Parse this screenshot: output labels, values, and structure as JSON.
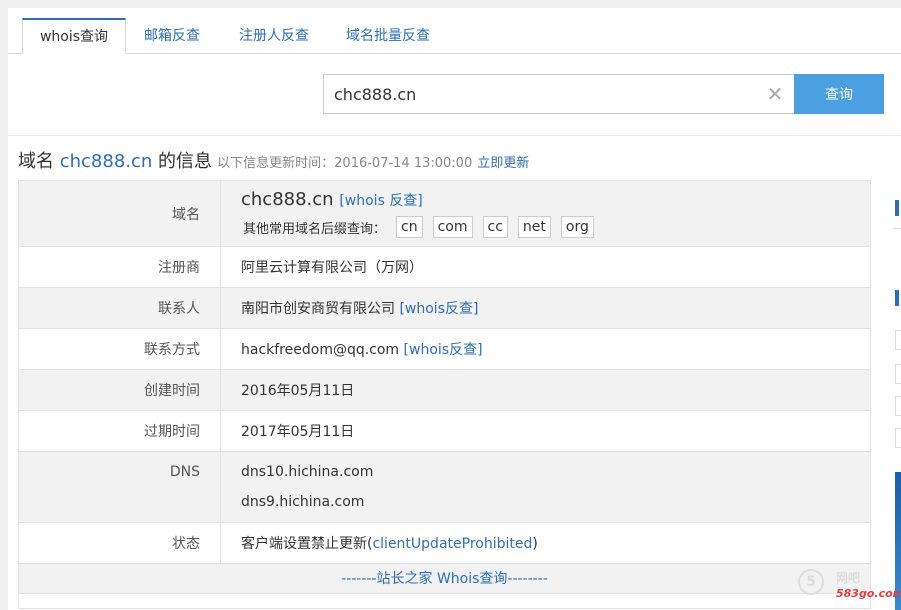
{
  "tabs": [
    {
      "label": "whois查询",
      "active": true
    },
    {
      "label": "邮箱反查",
      "active": false
    },
    {
      "label": "注册人反查",
      "active": false
    },
    {
      "label": "域名批量反查",
      "active": false
    }
  ],
  "search": {
    "value": "chc888.cn",
    "button_label": "查询"
  },
  "heading": {
    "prefix": "域名 ",
    "domain": "chc888.cn",
    "suffix": " 的信息",
    "update_text": "以下信息更新时间：2016-07-14 13:00:00",
    "update_link": "立即更新"
  },
  "table": {
    "domain": {
      "label": "域名",
      "value": "chc888.cn",
      "reverse_link": "[whois 反查]",
      "suffix_text": "其他常用域名后缀查询：",
      "suffixes": [
        "cn",
        "com",
        "cc",
        "net",
        "org"
      ]
    },
    "registrar": {
      "label": "注册商",
      "value": "阿里云计算有限公司（万网）"
    },
    "contact": {
      "label": "联系人",
      "value": "南阳市创安商贸有限公司",
      "link": "[whois反查]"
    },
    "contact_method": {
      "label": "联系方式",
      "value": "hackfreedom@qq.com",
      "link": "[whois反查]"
    },
    "created": {
      "label": "创建时间",
      "value": "2016年05月11日"
    },
    "expires": {
      "label": "过期时间",
      "value": "2017年05月11日"
    },
    "dns": {
      "label": "DNS",
      "values": [
        "dns10.hichina.com",
        "dns9.hichina.com"
      ]
    },
    "status": {
      "label": "状态",
      "prefix": "客户端设置禁止更新(",
      "code": "clientUpdateProhibited",
      "suffix": ")"
    },
    "footer": "-------站长之家 Whois查询--------"
  },
  "watermark": {
    "circle": "5",
    "text": "网吧",
    "url": "583go.com"
  }
}
